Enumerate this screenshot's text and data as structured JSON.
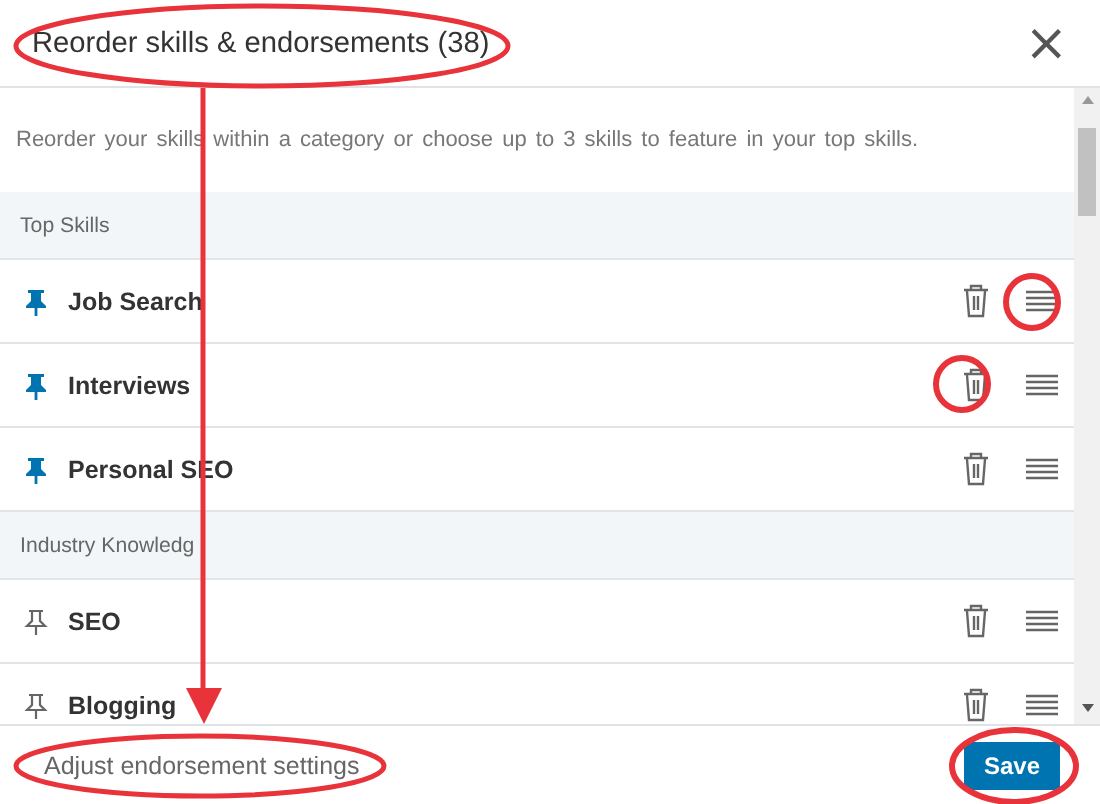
{
  "dialog": {
    "title": "Reorder skills & endorsements (38)",
    "close": "×"
  },
  "description": "Reorder your skills within a category or choose up to 3 skills to feature in your top skills.",
  "sections": [
    {
      "title": "Top Skills",
      "skills": [
        {
          "name": "Job Search",
          "pinned": true
        },
        {
          "name": "Interviews",
          "pinned": true
        },
        {
          "name": "Personal SEO",
          "pinned": true
        }
      ]
    },
    {
      "title": "Industry Knowledg",
      "skills": [
        {
          "name": "SEO",
          "pinned": false
        },
        {
          "name": "Blogging",
          "pinned": false
        }
      ]
    }
  ],
  "footer": {
    "link": "Adjust endorsement settings",
    "save": "Save"
  }
}
